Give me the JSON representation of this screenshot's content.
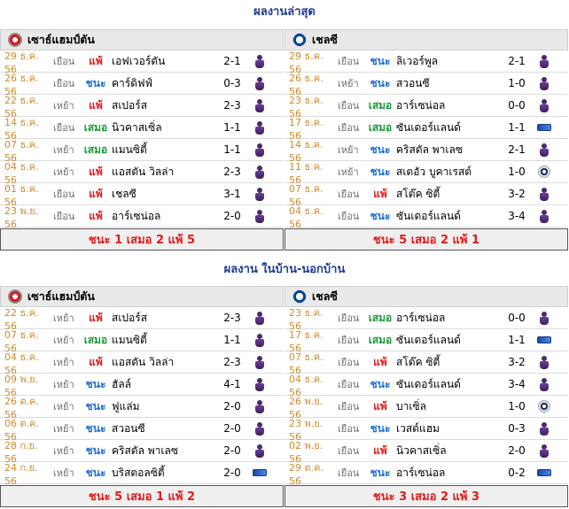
{
  "sections": [
    {
      "title": "ผลงานล่าสุด",
      "columns": [
        {
          "team": "เซาธ์แฮมป์ตัน",
          "rows": [
            {
              "date": "29 ธ.ค. 56",
              "venue": "เยือน",
              "result": "แพ้",
              "opponent": "เอฟเวอร์ตัน",
              "score": "2-1",
              "comp": "pl"
            },
            {
              "date": "26 ธ.ค. 56",
              "venue": "เยือน",
              "result": "ชนะ",
              "opponent": "คาร์ดิฟฟ์",
              "score": "0-3",
              "comp": "pl"
            },
            {
              "date": "22 ธ.ค. 56",
              "venue": "เหย้า",
              "result": "แพ้",
              "opponent": "สเปอร์ส",
              "score": "2-3",
              "comp": "pl"
            },
            {
              "date": "14 ธ.ค. 56",
              "venue": "เยือน",
              "result": "เสมอ",
              "opponent": "นิวคาสเซิ่ล",
              "score": "1-1",
              "comp": "pl"
            },
            {
              "date": "07 ธ.ค. 56",
              "venue": "เหย้า",
              "result": "เสมอ",
              "opponent": "แมนซิตี้",
              "score": "1-1",
              "comp": "pl"
            },
            {
              "date": "04 ธ.ค. 56",
              "venue": "เหย้า",
              "result": "แพ้",
              "opponent": "แอสตัน วิลล่า",
              "score": "2-3",
              "comp": "pl"
            },
            {
              "date": "01 ธ.ค. 56",
              "venue": "เยือน",
              "result": "แพ้",
              "opponent": "เชลซี",
              "score": "3-1",
              "comp": "pl"
            },
            {
              "date": "23 พ.ย. 56",
              "venue": "เยือน",
              "result": "แพ้",
              "opponent": "อาร์เซน่อล",
              "score": "2-0",
              "comp": "pl"
            }
          ],
          "summary": "ชนะ 1 เสมอ 2 แพ้ 5"
        },
        {
          "team": "เชลซี",
          "rows": [
            {
              "date": "29 ธ.ค. 56",
              "venue": "เยือน",
              "result": "ชนะ",
              "opponent": "ลิเวอร์พูล",
              "score": "2-1",
              "comp": "pl"
            },
            {
              "date": "26 ธ.ค. 56",
              "venue": "เหย้า",
              "result": "ชนะ",
              "opponent": "สวอนซี",
              "score": "1-0",
              "comp": "pl"
            },
            {
              "date": "23 ธ.ค. 56",
              "venue": "เยือน",
              "result": "เสมอ",
              "opponent": "อาร์เซน่อล",
              "score": "0-0",
              "comp": "pl"
            },
            {
              "date": "17 ธ.ค. 56",
              "venue": "เยือน",
              "result": "เสมอ",
              "opponent": "ซันเดอร์แลนด์",
              "score": "1-1",
              "comp": "cap"
            },
            {
              "date": "14 ธ.ค. 56",
              "venue": "เหย้า",
              "result": "ชนะ",
              "opponent": "คริสตัล พาเลซ",
              "score": "2-1",
              "comp": "pl"
            },
            {
              "date": "11 ธ.ค. 56",
              "venue": "เหย้า",
              "result": "ชนะ",
              "opponent": "สเตอัว บูคาเรสต์",
              "score": "1-0",
              "comp": "ucl"
            },
            {
              "date": "07 ธ.ค. 56",
              "venue": "เยือน",
              "result": "แพ้",
              "opponent": "สโต๊ค ซิตี้",
              "score": "3-2",
              "comp": "pl"
            },
            {
              "date": "04 ธ.ค. 56",
              "venue": "เยือน",
              "result": "ชนะ",
              "opponent": "ซันเดอร์แลนด์",
              "score": "3-4",
              "comp": "pl"
            }
          ],
          "summary": "ชนะ 5 เสมอ 2 แพ้ 1"
        }
      ]
    },
    {
      "title": "ผลงาน ในบ้าน-นอกบ้าน",
      "columns": [
        {
          "team": "เซาธ์แฮมป์ตัน",
          "rows": [
            {
              "date": "22 ธ.ค. 56",
              "venue": "เหย้า",
              "result": "แพ้",
              "opponent": "สเปอร์ส",
              "score": "2-3",
              "comp": "pl"
            },
            {
              "date": "07 ธ.ค. 56",
              "venue": "เหย้า",
              "result": "เสมอ",
              "opponent": "แมนซิตี้",
              "score": "1-1",
              "comp": "pl"
            },
            {
              "date": "04 ธ.ค. 56",
              "venue": "เหย้า",
              "result": "แพ้",
              "opponent": "แอสตัน วิลล่า",
              "score": "2-3",
              "comp": "pl"
            },
            {
              "date": "09 พ.ย. 56",
              "venue": "เหย้า",
              "result": "ชนะ",
              "opponent": "ฮัลล์",
              "score": "4-1",
              "comp": "pl"
            },
            {
              "date": "26 ต.ค. 56",
              "venue": "เหย้า",
              "result": "ชนะ",
              "opponent": "ฟูแล่ม",
              "score": "2-0",
              "comp": "pl"
            },
            {
              "date": "06 ต.ค. 56",
              "venue": "เหย้า",
              "result": "ชนะ",
              "opponent": "สวอนซี",
              "score": "2-0",
              "comp": "pl"
            },
            {
              "date": "28 ก.ย. 56",
              "venue": "เหย้า",
              "result": "ชนะ",
              "opponent": "คริสตัล พาเลซ",
              "score": "2-0",
              "comp": "pl"
            },
            {
              "date": "24 ก.ย. 56",
              "venue": "เหย้า",
              "result": "ชนะ",
              "opponent": "บริสตอลซิตี้",
              "score": "2-0",
              "comp": "cap"
            }
          ],
          "summary": "ชนะ 5 เสมอ 1 แพ้ 2"
        },
        {
          "team": "เชลซี",
          "rows": [
            {
              "date": "23 ธ.ค. 56",
              "venue": "เยือน",
              "result": "เสมอ",
              "opponent": "อาร์เซน่อล",
              "score": "0-0",
              "comp": "pl"
            },
            {
              "date": "17 ธ.ค. 56",
              "venue": "เยือน",
              "result": "เสมอ",
              "opponent": "ซันเดอร์แลนด์",
              "score": "1-1",
              "comp": "cap"
            },
            {
              "date": "07 ธ.ค. 56",
              "venue": "เยือน",
              "result": "แพ้",
              "opponent": "สโต๊ค ซิตี้",
              "score": "3-2",
              "comp": "pl"
            },
            {
              "date": "04 ธ.ค. 56",
              "venue": "เยือน",
              "result": "ชนะ",
              "opponent": "ซันเดอร์แลนด์",
              "score": "3-4",
              "comp": "pl"
            },
            {
              "date": "26 พ.ย. 56",
              "venue": "เยือน",
              "result": "แพ้",
              "opponent": "บาเซิ่ล",
              "score": "1-0",
              "comp": "ucl"
            },
            {
              "date": "23 พ.ย. 56",
              "venue": "เยือน",
              "result": "ชนะ",
              "opponent": "เวสต์แฮม",
              "score": "0-3",
              "comp": "pl"
            },
            {
              "date": "02 พ.ย. 56",
              "venue": "เยือน",
              "result": "แพ้",
              "opponent": "นิวคาสเซิ่ล",
              "score": "2-0",
              "comp": "pl"
            },
            {
              "date": "29 ต.ค. 56",
              "venue": "เยือน",
              "result": "ชนะ",
              "opponent": "อาร์เซน่อล",
              "score": "0-2",
              "comp": "cap"
            }
          ],
          "summary": "ชนะ 3 เสมอ 2 แพ้ 3"
        }
      ]
    }
  ],
  "colors": {
    "win": "#1f6fd8",
    "draw": "#1a9a3a",
    "lose": "#e11b1b",
    "date": "#d08a2a",
    "title": "#1f3a93"
  },
  "icons": {
    "pl": "premier-league-icon",
    "cap": "capital-one-cup-icon",
    "ucl": "champions-league-icon"
  }
}
